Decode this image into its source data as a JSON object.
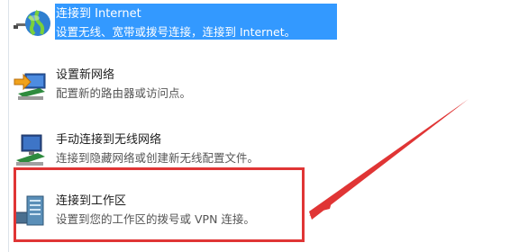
{
  "options": [
    {
      "title": "连接到 Internet",
      "desc": "设置无线、宽带或拨号连接，连接到 Internet。",
      "icon": "globe-network-icon",
      "selected": true
    },
    {
      "title": "设置新网络",
      "desc": "配置新的路由器或访问点。",
      "icon": "router-setup-icon",
      "selected": false
    },
    {
      "title": "手动连接到无线网络",
      "desc": "连接到隐藏网络或创建新无线配置文件。",
      "icon": "wireless-monitor-icon",
      "selected": false
    },
    {
      "title": "连接到工作区",
      "desc": "设置到您的工作区的拨号或 VPN 连接。",
      "icon": "workplace-server-icon",
      "selected": false
    }
  ],
  "colors": {
    "selection": "#3399ff",
    "highlight": "#e03535"
  }
}
